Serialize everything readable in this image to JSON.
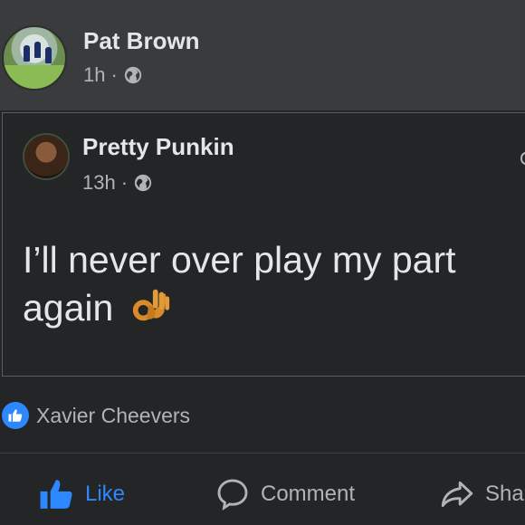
{
  "post": {
    "author": "Pat Brown",
    "time": "1h",
    "separator": "·",
    "visibility_icon": "globe-icon"
  },
  "shared_post": {
    "author": "Pretty Punkin",
    "time": "13h",
    "separator": "·",
    "visibility_icon": "globe-icon",
    "text": "I’ll never over play my part again",
    "emoji_icon": "ok-hand-icon"
  },
  "reactions": {
    "icon": "like-icon",
    "reactor": "Xavier Cheevers"
  },
  "actions": {
    "like_label": "Like",
    "comment_label": "Comment",
    "share_label": "Shar"
  },
  "colors": {
    "background": "#242526",
    "header_background": "#3a3b3c",
    "accent": "#2d88ff",
    "text_primary": "#e4e6eb",
    "text_secondary": "#b0b3b8"
  }
}
